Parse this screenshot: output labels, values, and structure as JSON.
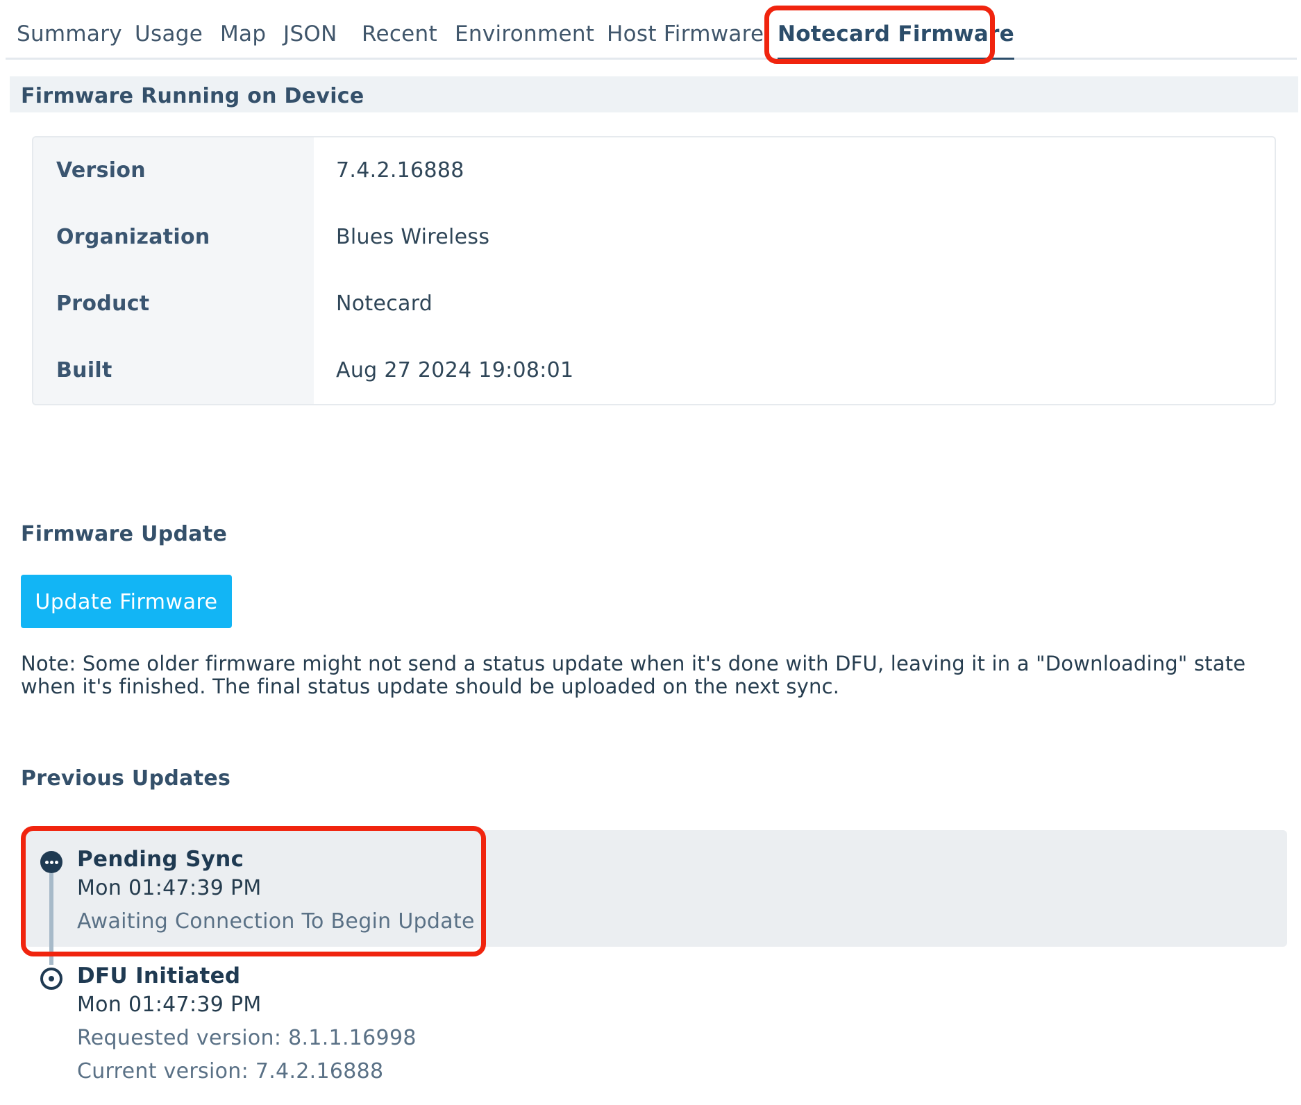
{
  "tabs": [
    {
      "label": "Summary"
    },
    {
      "label": "Usage"
    },
    {
      "label": "Map"
    },
    {
      "label": "JSON"
    },
    {
      "label": "Recent"
    },
    {
      "label": "Environment"
    },
    {
      "label": "Host Firmware"
    },
    {
      "label": "Notecard Firmware",
      "active": true
    }
  ],
  "running": {
    "title": "Firmware Running on Device",
    "rows": [
      {
        "label": "Version",
        "value": "7.4.2.16888"
      },
      {
        "label": "Organization",
        "value": "Blues Wireless"
      },
      {
        "label": "Product",
        "value": "Notecard"
      },
      {
        "label": "Built",
        "value": "Aug 27 2024 19:08:01"
      }
    ]
  },
  "update": {
    "title": "Firmware Update",
    "button_label": "Update Firmware",
    "note": "Note: Some older firmware might not send a status update when it's done with DFU, leaving it in a \"Downloading\" state when it's finished. The final status update should be uploaded on the next sync."
  },
  "previous": {
    "title": "Previous Updates",
    "items": [
      {
        "title": "Pending Sync",
        "time": "Mon 01:47:39 PM",
        "details": [
          "Awaiting Connection To Begin Update"
        ],
        "icon": "ellipsis-circle-icon"
      },
      {
        "title": "DFU Initiated",
        "time": "Mon 01:47:39 PM",
        "details": [
          "Requested version: 8.1.1.16998",
          "Current version: 7.4.2.16888"
        ],
        "icon": "target-circle-icon"
      }
    ]
  },
  "colors": {
    "accent": "#12b5f5",
    "highlight": "#f0240e",
    "text_dark": "#1f3a52"
  }
}
